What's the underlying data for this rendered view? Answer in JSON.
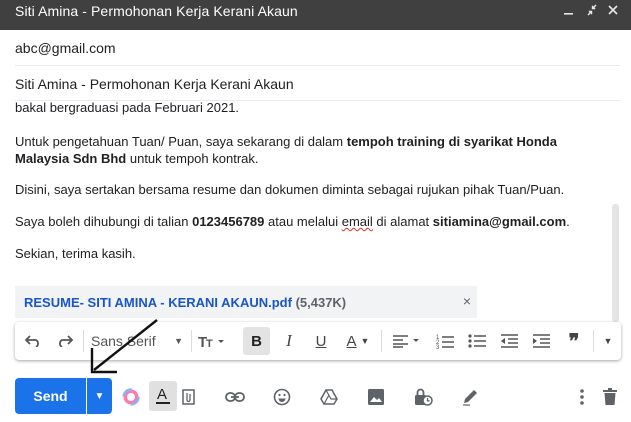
{
  "window": {
    "title": "Siti Amina - Permohonan Kerja Kerani Akaun",
    "controls": [
      "minimize-icon",
      "shrink-icon",
      "close-icon"
    ]
  },
  "recipients": {
    "to": "abc@gmail.com"
  },
  "subject": "Siti Amina - Permohonan Kerja Kerani Akaun",
  "body": {
    "line1": "bakal bergraduasi pada Februari 2021.",
    "p2_text1": "Untuk pengetahuan Tuan/ Puan, saya sekarang di dalam ",
    "p2_bold": "tempoh training di syarikat Honda Malaysia Sdn Bhd",
    "p2_text2": " untuk tempoh kontrak.",
    "p3": "Disini, saya sertakan bersama resume dan dokumen diminta sebagai rujukan pihak Tuan/Puan.",
    "p4_text1": "Saya boleh dihubungi di talian ",
    "p4_phone": "0123456789",
    "p4_text2": " atau melalui ",
    "p4_email_word": "email",
    "p4_text3": " di alamat ",
    "p4_email": "sitiamina@gmail.com",
    "p4_text4": ".",
    "p5": "Sekian, terima kasih."
  },
  "attachment": {
    "name": "RESUME- SITI AMINA - KERANI AKAUN.pdf",
    "size": "(5,437K)",
    "remove_glyph": "×"
  },
  "formatting_toolbar": {
    "font_label": "Sans Serif",
    "bold": "B",
    "italic": "I",
    "underline": "U",
    "text_color": "A",
    "quote": "❞",
    "items": [
      "undo-icon",
      "redo-icon",
      "font-select",
      "font-size-icon",
      "bold-icon",
      "italic-icon",
      "underline-icon",
      "text-color-icon",
      "align-icon",
      "numbered-list-icon",
      "bulleted-list-icon",
      "indent-less-icon",
      "indent-more-icon",
      "quote-icon",
      "more-formatting-icon"
    ]
  },
  "bottom_toolbar": {
    "send_label": "Send",
    "icons": [
      "send-options-icon",
      "color-palette-icon",
      "formatting-options-icon",
      "attach-file-icon",
      "insert-link-icon",
      "insert-emoji-icon",
      "google-drive-icon",
      "insert-photo-icon",
      "confidential-mode-icon",
      "signature-icon",
      "more-options-icon",
      "discard-draft-icon"
    ]
  },
  "colors": {
    "titlebar": "#404040",
    "send": "#1a73e8",
    "attachment_link": "#1a56c8",
    "annotation_arrow": "#000000"
  }
}
